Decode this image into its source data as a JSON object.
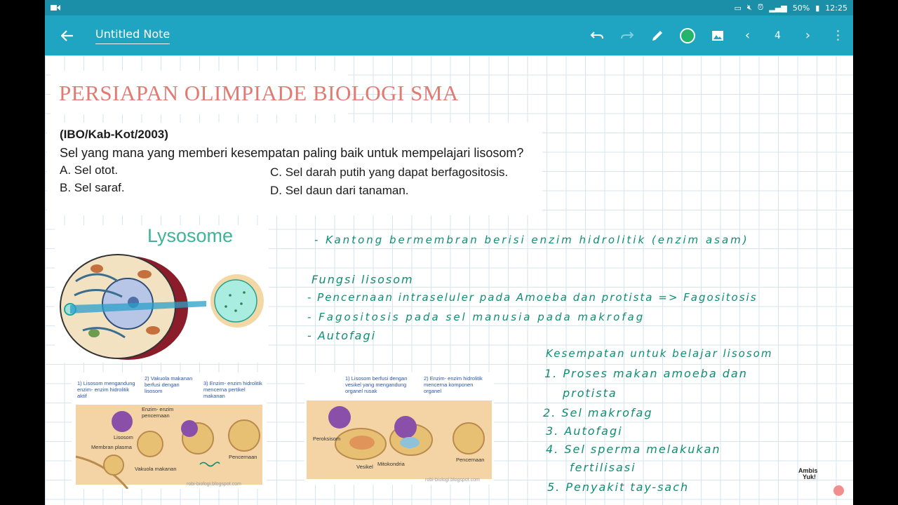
{
  "status": {
    "battery": "50%",
    "time": "12:25"
  },
  "toolbar": {
    "title": "Untitled Note",
    "page": "4"
  },
  "colors": {
    "toolbar": "#1fa5c1",
    "pen": "#22b56b",
    "ink": "#0f8d72",
    "heading": "#e27a72"
  },
  "note": {
    "heading": "PERSIAPAN OLIMPIADE BIOLOGI SMA",
    "question": {
      "source": "(IBO/Kab-Kot/2003)",
      "text": "Sel yang mana yang memberi kesempatan paling baik untuk mempelajari lisosom?",
      "options": [
        "A.  Sel otot.",
        "B.  Sel saraf.",
        "C.  Sel darah putih yang dapat berfagositosis.",
        "D.  Sel daun dari tanaman."
      ]
    },
    "image_title": "Lysosome",
    "diagram1": {
      "labels": [
        "1) Lisosom mengandung enzim- enzim hidrolitik aktif",
        "2) Vakuola makanan berfusi dengan lisosom",
        "3) Enzim- enzim hidrolitik mencerna pertikel makanan",
        "Enzim- enzim pencernaan",
        "Lisosom",
        "Membran plasma",
        "Vakuola makanan",
        "Pencernaan"
      ],
      "credit": "robi-biologi.blogspot.com"
    },
    "diagram2": {
      "labels": [
        "1) Lisosom berfusi dengan vesikel yang mengandung organel rusak",
        "2) Enzim- enzim hidrolitik mencerna komponen organel",
        "Peroksisom",
        "Vesikel",
        "Mitokondria",
        "Pencernaan"
      ],
      "credit": "robi-biologi.blogspot.com"
    },
    "handwriting": [
      "- Kantong bermembran berisi enzim hidrolitik (enzim asam)",
      "Fungsi lisosom",
      "- Pencernaan intraseluler pada Amoeba dan protista => Fagositosis",
      "- Fagositosis pada sel manusia pada makrofag",
      "- Autofagi",
      "Kesempatan untuk belajar lisosom",
      "1. Proses makan amoeba dan",
      "protista",
      "2. Sel makrofag",
      "3. Autofagi",
      "4. Sel sperma melakukan",
      "fertilisasi",
      "5. Penyakit tay-sach"
    ],
    "logo": {
      "line1": "Ambis",
      "line2": "Yuk!"
    }
  }
}
